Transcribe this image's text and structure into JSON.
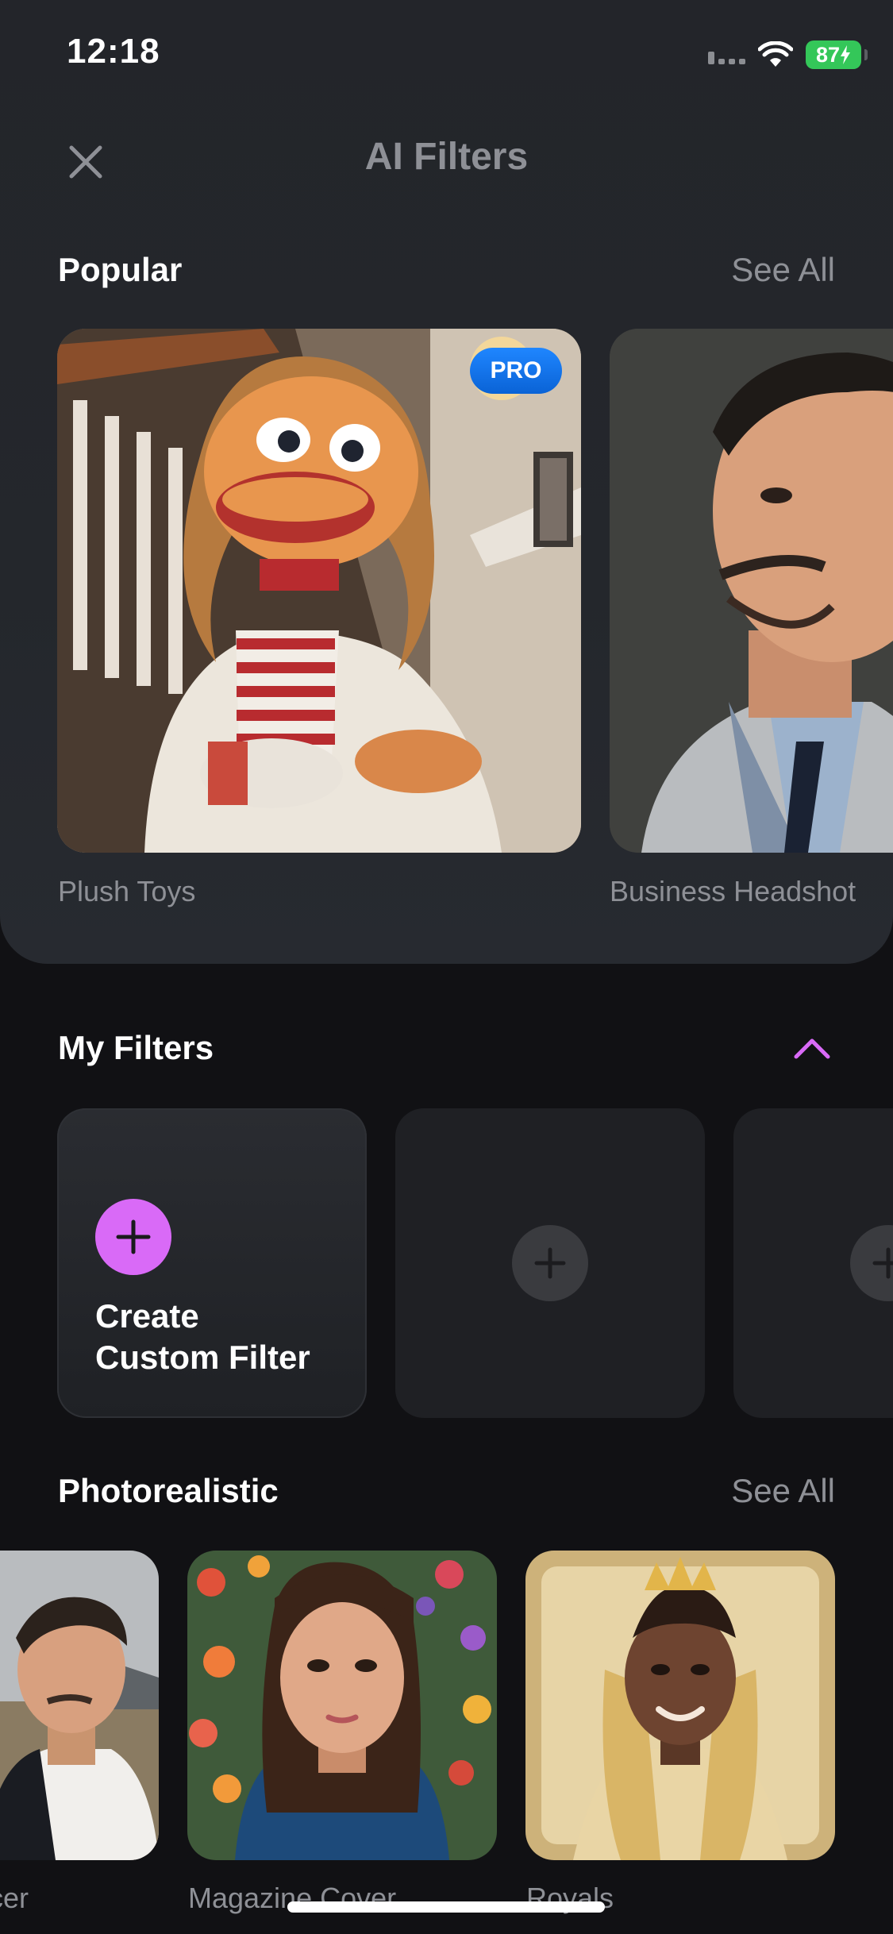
{
  "status_bar": {
    "time": "12:18",
    "battery": "87"
  },
  "header": {
    "title": "AI Filters"
  },
  "popular": {
    "title": "Popular",
    "see_all": "See All",
    "items": [
      {
        "label": "Plush Toys",
        "badge": "PRO"
      },
      {
        "label": "Business Headshot"
      }
    ]
  },
  "my_filters": {
    "title": "My Filters",
    "create_label_line1": "Create",
    "create_label_line2": "Custom Filter"
  },
  "photorealistic": {
    "title": "Photorealistic",
    "see_all": "See All",
    "items": [
      {
        "label": "cer"
      },
      {
        "label": "Magazine Cover"
      },
      {
        "label": "Royals"
      }
    ]
  },
  "colors": {
    "accent": "#d96af7",
    "pro_badge": "#1f86ff",
    "battery": "#34c759"
  }
}
